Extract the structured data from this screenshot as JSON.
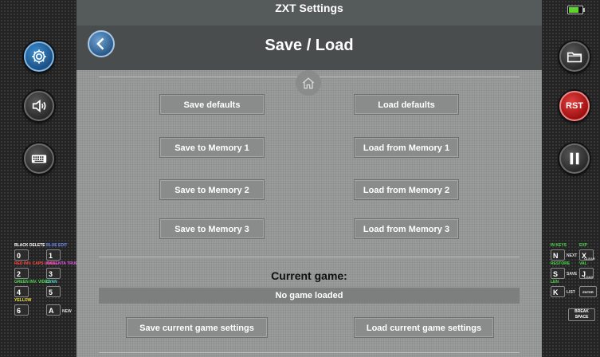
{
  "header": {
    "title": "ZXT Settings"
  },
  "page": {
    "title": "Save / Load"
  },
  "buttons": {
    "save_defaults": "Save defaults",
    "load_defaults": "Load defaults",
    "save_mem1": "Save to Memory 1",
    "load_mem1": "Load from Memory 1",
    "save_mem2": "Save to Memory 2",
    "load_mem2": "Load from Memory 2",
    "save_mem3": "Save to Memory 3",
    "load_mem3": "Load from Memory 3"
  },
  "current_game": {
    "label": "Current game:",
    "status": "No game loaded",
    "save_settings": "Save current game settings",
    "load_settings": "Load current game settings"
  },
  "right_panel": {
    "reset_label": "RST"
  },
  "icons": {
    "settings": "gear-icon",
    "sound": "speaker-icon",
    "keyboard": "keyboard-icon",
    "back": "chevron-left-icon",
    "home": "home-icon",
    "folder": "folder-icon",
    "pause": "pause-icon",
    "battery": "battery-icon"
  },
  "colors": {
    "accent_blue": "#2a6fb0",
    "reset_red": "#c81e1e",
    "battery_green": "#5ed32c"
  },
  "left_keys": {
    "col1": [
      {
        "top": "BLACK DELETE",
        "cap": "0",
        "small": ""
      },
      {
        "top": "RED INV. CAPS LOCK",
        "cap": "2",
        "small": ""
      },
      {
        "top": "GREEN INV. VIDEO",
        "cap": "4",
        "small": ""
      },
      {
        "top": "YELLOW",
        "cap": "6",
        "small": ""
      }
    ],
    "col2": [
      {
        "top": "BLUE EDIT",
        "cap": "1",
        "small": ""
      },
      {
        "top": "MAGENTA TRUE VIDEO",
        "cap": "3",
        "small": ""
      },
      {
        "top": "CYAN",
        "cap": "5",
        "small": ""
      },
      {
        "top": "NEW",
        "cap": "A",
        "small": ""
      }
    ]
  },
  "right_keys": {
    "col1": [
      {
        "top": "IN KEYS",
        "cap": "N",
        "small": "NEXT"
      },
      {
        "top": "RESTORE",
        "cap": "S",
        "small": "SAVE"
      },
      {
        "top": "LEN",
        "cap": "K",
        "small": "LIST"
      },
      {
        "top": "",
        "cap": "BREAK",
        "small": "SPACE"
      }
    ],
    "col2": [
      {
        "top": "EXP",
        "cap": "X",
        "small": "CLEAR"
      },
      {
        "top": "VAL",
        "cap": "J",
        "small": "LOAD"
      },
      {
        "top": "",
        "cap": "",
        "small": "ENTER"
      }
    ]
  }
}
